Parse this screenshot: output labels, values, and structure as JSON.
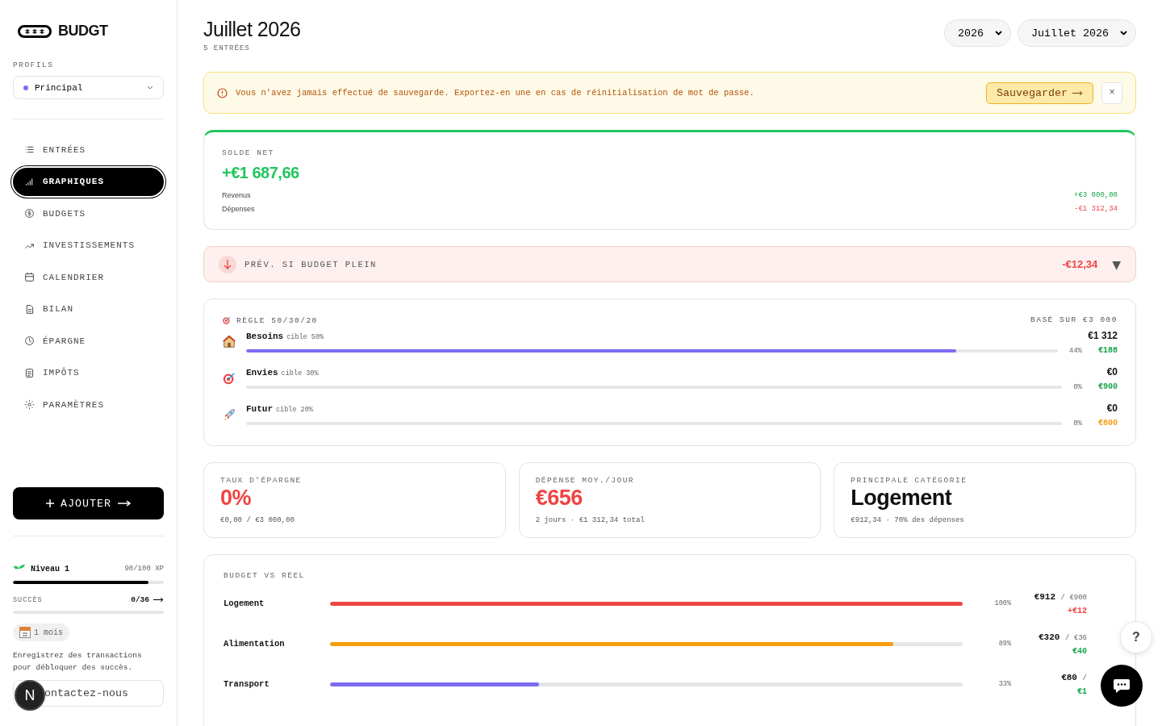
{
  "sidebar": {
    "logo": "BUDGT",
    "profiles_label": "PROFILS",
    "profile": {
      "name": "Principal",
      "color": "#7c6cf0"
    },
    "nav": [
      {
        "label": "ENTRÉES",
        "selected": false
      },
      {
        "label": "GRAPHIQUES",
        "selected": true
      },
      {
        "label": "BUDGETS",
        "selected": false
      },
      {
        "label": "INVESTISSEMENTS",
        "selected": false
      },
      {
        "label": "CALENDRIER",
        "selected": false
      },
      {
        "label": "BILAN",
        "selected": false
      },
      {
        "label": "ÉPARGNE",
        "selected": false
      },
      {
        "label": "IMPÔTS",
        "selected": false
      },
      {
        "label": "PARAMÈTRES",
        "selected": false
      }
    ],
    "add_button": "AJOUTER",
    "level": {
      "label": "Niveau 1",
      "xp": "90/100 XP",
      "level": 0.9
    },
    "achievements": {
      "label": "SUCCÈS",
      "count": "0/36",
      "level": 0
    },
    "badge": "1 mois",
    "hint": "Enregistrez des transactions pour débloquer des succès.",
    "contact": "ontactez-nous",
    "dev_badge": "N"
  },
  "header": {
    "title": "Juillet 2026",
    "subtitle": "5 ENTRÉES",
    "selects": [
      "2026",
      "Juillet 2026"
    ]
  },
  "alert": {
    "text": "Vous n'avez jamais effectué de sauvegarde. Exportez-en une en cas de réinitialisation de mot de passe.",
    "button": "Sauvegarder",
    "close": "×"
  },
  "net": {
    "label": "SOLDE NET",
    "value": "+€1 687,66",
    "rows": [
      {
        "label": "Revenus",
        "value": "+€3 000,00",
        "kind": "positive"
      },
      {
        "label": "Dépenses",
        "value": "-€1 312,34",
        "kind": "negative"
      }
    ]
  },
  "forecast": {
    "label": "PRÉV. SI BUDGET PLEIN",
    "value": "-€12,34",
    "toggle": "▼"
  },
  "rule": {
    "title": "RÈGLE 50/30/20",
    "basis": "BASÉ SUR €3 000",
    "rows": [
      {
        "kind": "house",
        "name": "Besoins",
        "target": "cible 50%",
        "amount": "€1 312",
        "percent": "44%",
        "remaining": "€188",
        "level": 0.875,
        "color": "#16a34a"
      },
      {
        "kind": "target",
        "name": "Envies",
        "target": "cible 30%",
        "amount": "€0",
        "percent": "0%",
        "remaining": "€900",
        "level": 0,
        "color": "#16a34a"
      },
      {
        "kind": "rocket",
        "name": "Futur",
        "target": "cible 20%",
        "amount": "€0",
        "percent": "0%",
        "remaining": "€600",
        "level": 0,
        "color": "#f59e0b"
      }
    ]
  },
  "stats": [
    {
      "label": "TAUX D'ÉPARGNE",
      "value": "0%",
      "detail": "€0,00 / €3 000,00",
      "kind": "negative"
    },
    {
      "label": "DÉPENSE MOY./JOUR",
      "value": "€656",
      "detail": "2 jours · €1 312,34 total",
      "kind": "negative"
    },
    {
      "label": "PRINCIPALE CATÉGORIE",
      "value": "Logement",
      "detail": "€912,34 · 70% des dépenses",
      "kind": "neutral"
    }
  ],
  "budget": {
    "title": "BUDGET VS RÉEL",
    "rows": [
      {
        "name": "Logement",
        "level": 1,
        "color": "#ef4444",
        "percent": "100%",
        "actual": "€912",
        "budget": "/ €900",
        "diff": {
          "text": "+€12",
          "color": "#ef4444"
        }
      },
      {
        "name": "Alimentation",
        "level": 0.89,
        "color": "#f59e0b",
        "percent": "89%",
        "actual": "€320",
        "budget": "/ €36",
        "diff": {
          "text": "€40",
          "color": "#16a34a"
        }
      },
      {
        "name": "Transport",
        "level": 0.33,
        "color": "#7c6cf0",
        "percent": "33%",
        "actual": "€80",
        "budget": "/",
        "diff": {
          "text": "€1",
          "color": "#16a34a"
        }
      }
    ]
  },
  "help": "?"
}
